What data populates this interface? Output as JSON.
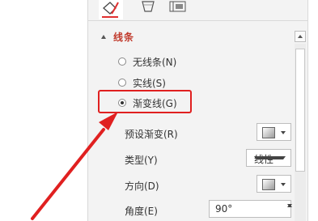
{
  "section": {
    "title": "线条"
  },
  "line_options": [
    {
      "label": "无线条(N)",
      "selected": false
    },
    {
      "label": "实线(S)",
      "selected": false
    },
    {
      "label": "渐变线(G)",
      "selected": true
    }
  ],
  "properties": {
    "preset_gradient": "预设渐变(R)",
    "type": {
      "label": "类型(Y)",
      "value": "线性"
    },
    "direction": "方向(D)",
    "angle": {
      "label": "角度(E)",
      "value": "90°"
    }
  },
  "colors": {
    "section_title": "#c0392b",
    "annotation": "#e02020"
  },
  "icons": [
    "fill-line-tab-icon",
    "effects-tab-icon",
    "size-properties-tab-icon",
    "annotation-arrow"
  ]
}
